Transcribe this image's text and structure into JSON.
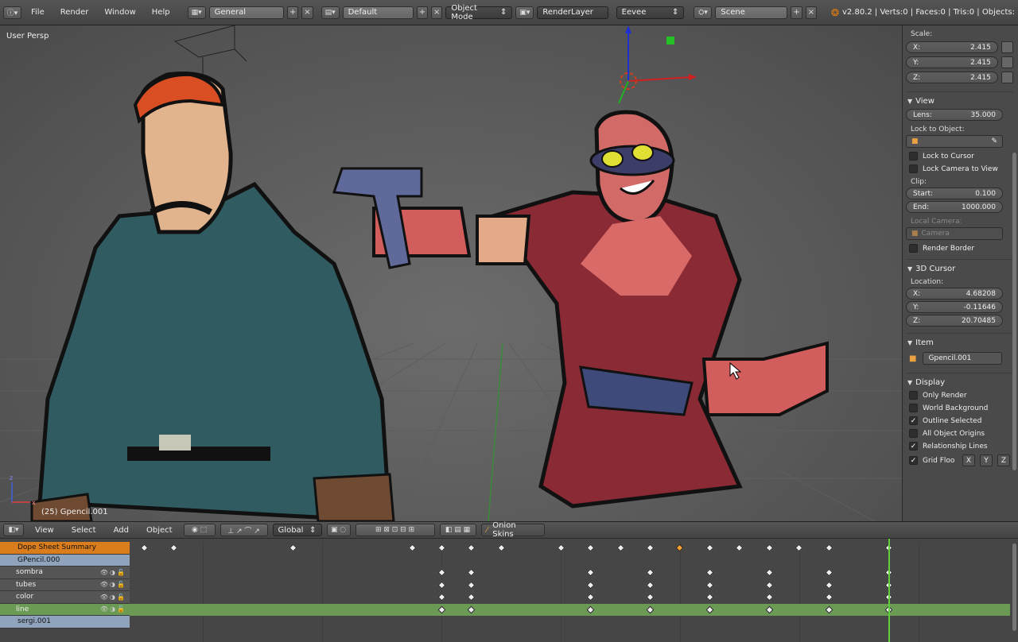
{
  "topbar": {
    "menus": [
      "File",
      "Render",
      "Window",
      "Help"
    ],
    "screen_layout": "General",
    "scene_layout": "Default",
    "mode": "Object Mode",
    "render_layer": "RenderLayer",
    "engine": "Eevee",
    "scene": "Scene",
    "stats": "v2.80.2 | Verts:0 | Faces:0 | Tris:0 | Objects:"
  },
  "viewport": {
    "label": "User Persp",
    "object_label": "(25) Gpencil.001"
  },
  "props": {
    "scale_label": "Scale:",
    "scale": [
      {
        "axis": "X:",
        "value": "2.415"
      },
      {
        "axis": "Y:",
        "value": "2.415"
      },
      {
        "axis": "Z:",
        "value": "2.415"
      }
    ],
    "view_header": "View",
    "lens_label": "Lens:",
    "lens_value": "35.000",
    "lock_to_object": "Lock to Object:",
    "lock_to_cursor": "Lock to Cursor",
    "lock_camera": "Lock Camera to View",
    "clip_label": "Clip:",
    "clip_start_label": "Start:",
    "clip_start": "0.100",
    "clip_end_label": "End:",
    "clip_end": "1000.000",
    "local_camera": "Local Camera:",
    "camera": "Camera",
    "render_border": "Render Border",
    "cursor_header": "3D Cursor",
    "location_label": "Location:",
    "location": [
      {
        "axis": "X:",
        "value": "4.68208"
      },
      {
        "axis": "Y:",
        "value": "-0.11646"
      },
      {
        "axis": "Z:",
        "value": "20.70485"
      }
    ],
    "item_header": "Item",
    "item_name": "Gpencil.001",
    "display_header": "Display",
    "display": [
      {
        "label": "Only Render",
        "checked": false
      },
      {
        "label": "World Background",
        "checked": false
      },
      {
        "label": "Outline Selected",
        "checked": true
      },
      {
        "label": "All Object Origins",
        "checked": false
      },
      {
        "label": "Relationship Lines",
        "checked": true
      }
    ],
    "grid_floor": "Grid Floo",
    "axes": [
      "X",
      "Y",
      "Z"
    ]
  },
  "dopesheet": {
    "menus": [
      "View",
      "Select",
      "Add",
      "Object"
    ],
    "orientation": "Global",
    "onion": "Onion Skins",
    "channels": [
      {
        "name": "Dope Sheet Summary",
        "kind": "summary"
      },
      {
        "name": "GPencil.000",
        "kind": "obj"
      },
      {
        "name": "sombra",
        "kind": "layer"
      },
      {
        "name": "tubes",
        "kind": "layer"
      },
      {
        "name": "color",
        "kind": "layer"
      },
      {
        "name": "line",
        "kind": "layer"
      },
      {
        "name": "sergi.001",
        "kind": "obj"
      }
    ]
  }
}
